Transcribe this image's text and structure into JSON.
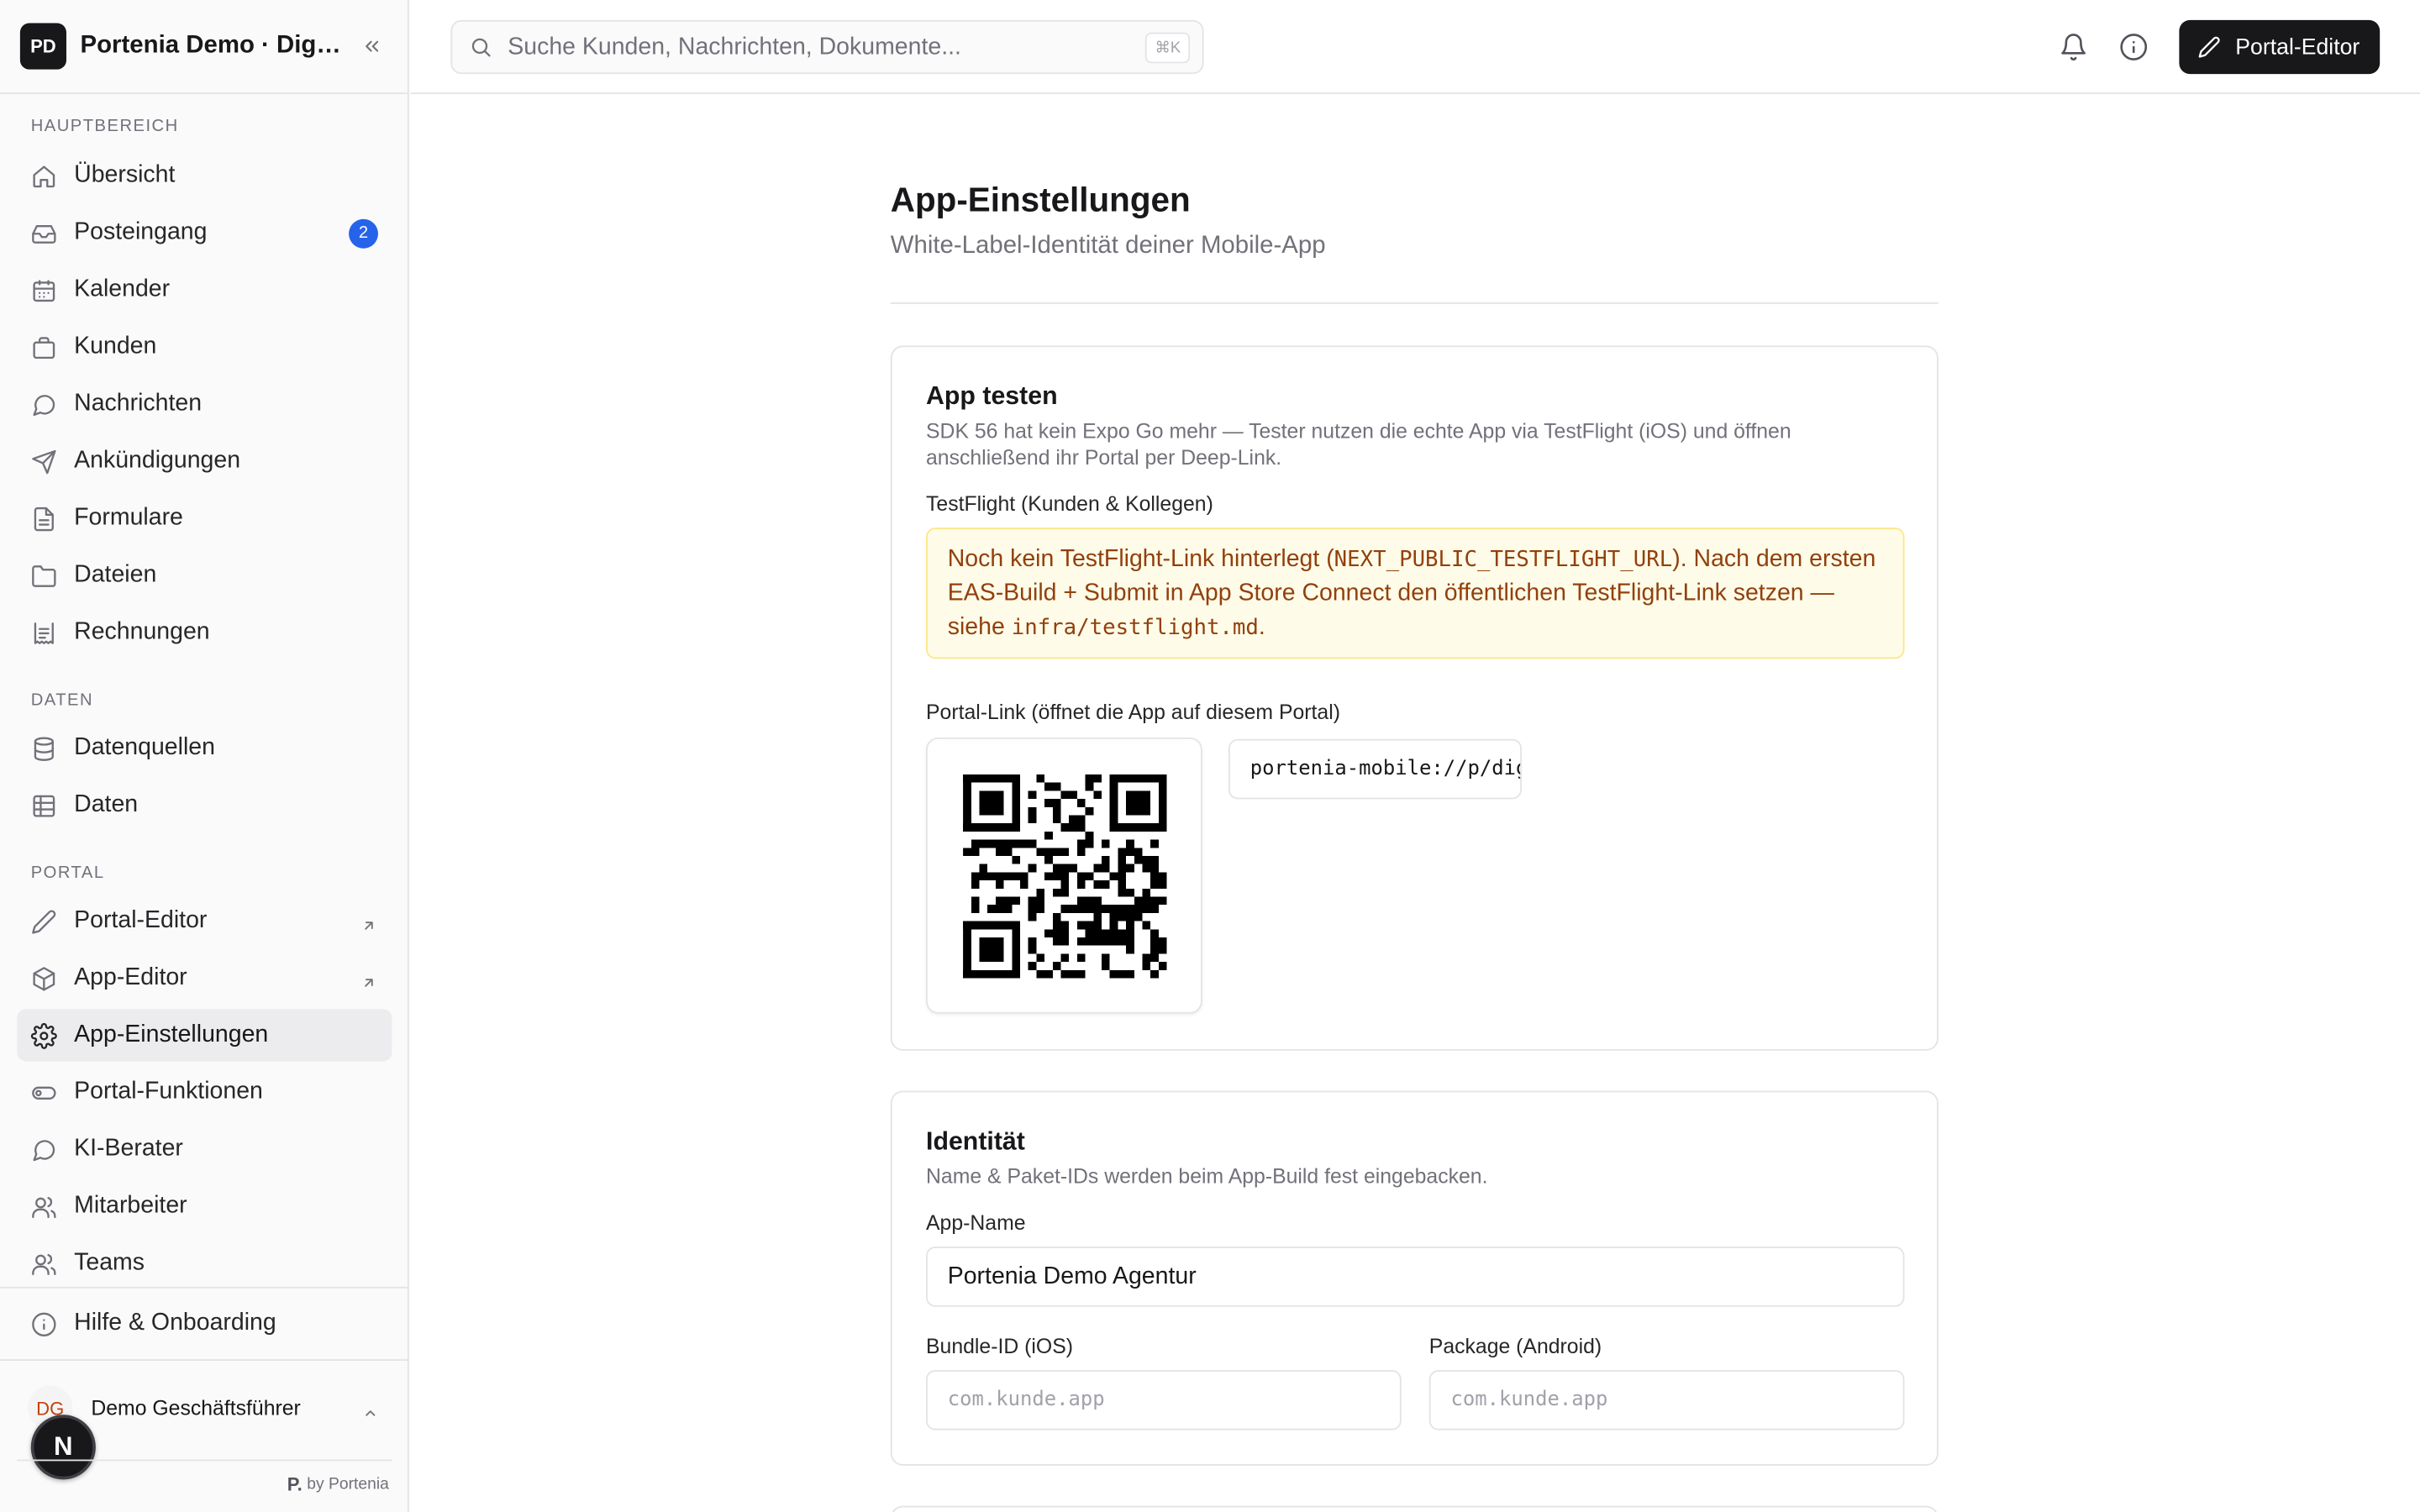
{
  "workspace": {
    "initials": "PD",
    "name": "Portenia Demo · Digitalagentur"
  },
  "search": {
    "placeholder": "Suche Kunden, Nachrichten, Dokumente...",
    "shortcut": "⌘K"
  },
  "header": {
    "portal_editor_label": "Portal-Editor"
  },
  "sidebar": {
    "sections": [
      {
        "label": "HAUPTBEREICH"
      },
      {
        "label": "DATEN"
      },
      {
        "label": "PORTAL"
      }
    ],
    "items": [
      {
        "label": "Übersicht",
        "icon": "home-icon"
      },
      {
        "label": "Posteingang",
        "icon": "inbox-icon",
        "badge": "2"
      },
      {
        "label": "Kalender",
        "icon": "calendar-icon"
      },
      {
        "label": "Kunden",
        "icon": "briefcase-icon"
      },
      {
        "label": "Nachrichten",
        "icon": "chat-icon"
      },
      {
        "label": "Ankündigungen",
        "icon": "send-icon"
      },
      {
        "label": "Formulare",
        "icon": "file-icon"
      },
      {
        "label": "Dateien",
        "icon": "folder-icon"
      },
      {
        "label": "Rechnungen",
        "icon": "receipt-icon"
      },
      {
        "label": "Datenquellen",
        "icon": "database-icon"
      },
      {
        "label": "Daten",
        "icon": "table-icon"
      },
      {
        "label": "Portal-Editor",
        "icon": "pencil-icon"
      },
      {
        "label": "App-Editor",
        "icon": "box-icon"
      },
      {
        "label": "App-Einstellungen",
        "icon": "gear-icon"
      },
      {
        "label": "Portal-Funktionen",
        "icon": "toggle-icon"
      },
      {
        "label": "KI-Berater",
        "icon": "chat-icon"
      },
      {
        "label": "Mitarbeiter",
        "icon": "users-icon"
      },
      {
        "label": "Teams",
        "icon": "users-icon"
      },
      {
        "label": "Hilfe & Onboarding",
        "icon": "info-icon"
      }
    ],
    "user": {
      "initials": "DG",
      "name": "Demo Geschäftsführer"
    },
    "dev_badge": "N",
    "byline": {
      "mark": "P.",
      "text": "by Portenia"
    }
  },
  "page": {
    "title": "App-Einstellungen",
    "subtitle": "White-Label-Identität deiner Mobile-App"
  },
  "test_card": {
    "title": "App testen",
    "description": "SDK 56 hat kein Expo Go mehr — Tester nutzen die echte App via TestFlight (iOS) und öffnen anschließend ihr Portal per Deep-Link.",
    "testflight_label": "TestFlight (Kunden & Kollegen)",
    "warning_part1": "Noch kein TestFlight-Link hinterlegt (",
    "warning_code1": "NEXT_PUBLIC_TESTFLIGHT_URL",
    "warning_part2": "). Nach dem ersten EAS-Build + Submit in App Store Connect den öffentlichen TestFlight-Link setzen — siehe ",
    "warning_code2": "infra/testflight.md",
    "warning_part3": ".",
    "portal_link_label": "Portal-Link (öffnet die App auf diesem Portal)",
    "portal_link_value": "portenia-mobile://p/digitalagentur"
  },
  "identity_card": {
    "title": "Identität",
    "description": "Name & Paket-IDs werden beim App-Build fest eingebacken.",
    "app_name_label": "App-Name",
    "app_name_value": "Portenia Demo Agentur",
    "bundle_label": "Bundle-ID (iOS)",
    "bundle_placeholder": "com.kunde.app",
    "package_label": "Package (Android)",
    "package_placeholder": "com.kunde.app"
  },
  "colors": {
    "accent": "#18181b",
    "badge": "#2563eb",
    "warning_bg": "#fefce8",
    "warning_text": "#92400e"
  }
}
